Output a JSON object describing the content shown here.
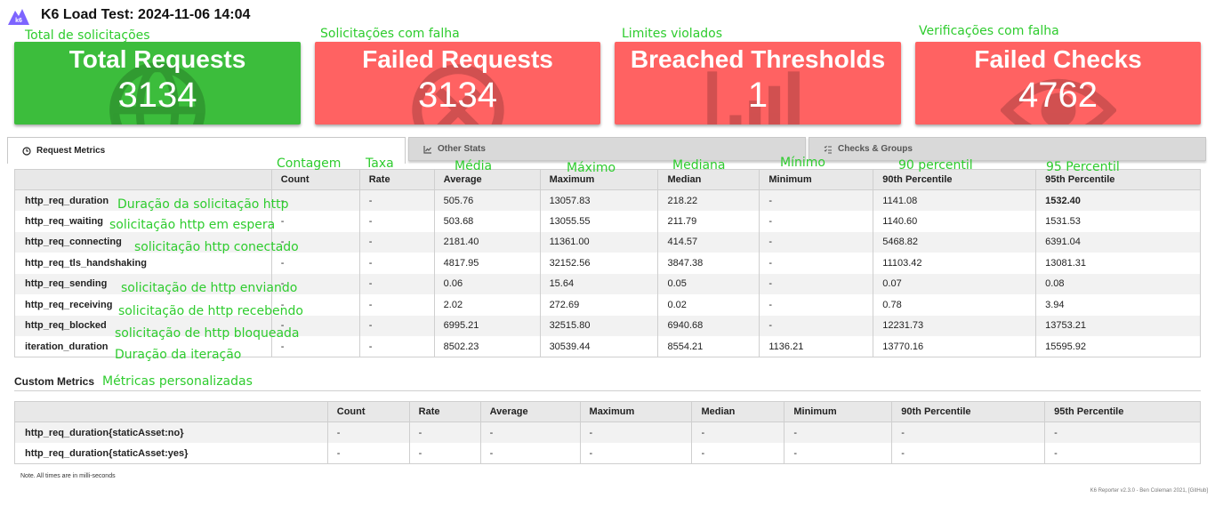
{
  "header": {
    "logo_text": "k6",
    "title": "K6 Load Test: 2024-11-06 14:04"
  },
  "cards": [
    {
      "title": "Total Requests",
      "value": "3134",
      "color": "#3cbd3c",
      "icon": "globe-icon"
    },
    {
      "title": "Failed Requests",
      "value": "3134",
      "color": "#ff6262",
      "icon": "x-circle-icon"
    },
    {
      "title": "Breached Thresholds",
      "value": "1",
      "color": "#ff6262",
      "icon": "bar-chart-icon"
    },
    {
      "title": "Failed Checks",
      "value": "4762",
      "color": "#ff6262",
      "icon": "eye-icon"
    }
  ],
  "tabs": [
    {
      "label": "Request Metrics",
      "icon": "clock-icon",
      "active": true
    },
    {
      "label": "Other Stats",
      "icon": "chart-line-icon",
      "active": false
    },
    {
      "label": "Checks & Groups",
      "icon": "list-check-icon",
      "active": false
    }
  ],
  "request_table": {
    "headers": [
      "",
      "Count",
      "Rate",
      "Average",
      "Maximum",
      "Median",
      "Minimum",
      "90th Percentile",
      "95th Percentile"
    ],
    "rows": [
      [
        "http_req_duration",
        "-",
        "-",
        "505.76",
        "13057.83",
        "218.22",
        "-",
        "1141.08",
        "1532.40"
      ],
      [
        "http_req_waiting",
        "-",
        "-",
        "503.68",
        "13055.55",
        "211.79",
        "-",
        "1140.60",
        "1531.53"
      ],
      [
        "http_req_connecting",
        "-",
        "-",
        "2181.40",
        "11361.00",
        "414.57",
        "-",
        "5468.82",
        "6391.04"
      ],
      [
        "http_req_tls_handshaking",
        "-",
        "-",
        "4817.95",
        "32152.56",
        "3847.38",
        "-",
        "11103.42",
        "13081.31"
      ],
      [
        "http_req_sending",
        "-",
        "-",
        "0.06",
        "15.64",
        "0.05",
        "-",
        "0.07",
        "0.08"
      ],
      [
        "http_req_receiving",
        "-",
        "-",
        "2.02",
        "272.69",
        "0.02",
        "-",
        "0.78",
        "3.94"
      ],
      [
        "http_req_blocked",
        "-",
        "-",
        "6995.21",
        "32515.80",
        "6940.68",
        "-",
        "12231.73",
        "13753.21"
      ],
      [
        "iteration_duration",
        "-",
        "-",
        "8502.23",
        "30539.44",
        "8554.21",
        "1136.21",
        "13770.16",
        "15595.92"
      ]
    ],
    "breached_color": "#ff6262"
  },
  "custom_section_title": "Custom Metrics",
  "custom_table": {
    "headers": [
      "",
      "Count",
      "Rate",
      "Average",
      "Maximum",
      "Median",
      "Minimum",
      "90th Percentile",
      "95th Percentile"
    ],
    "rows": [
      [
        "http_req_duration{staticAsset:no}",
        "-",
        "-",
        "-",
        "-",
        "-",
        "-",
        "-",
        "-"
      ],
      [
        "http_req_duration{staticAsset:yes}",
        "-",
        "-",
        "-",
        "-",
        "-",
        "-",
        "-",
        "-"
      ]
    ]
  },
  "note": "Note. All times are in milli-seconds",
  "footer": "K6 Reporter v2.3.0 - Ben Coleman 2021, [GitHub]",
  "translations": {
    "card_total": "Total de solicitações",
    "card_failed": "Solicitações com falha",
    "card_thresholds": "Limites violados",
    "card_checks": "Verificações com falha",
    "col_count": "Contagem",
    "col_rate": "Taxa",
    "col_average": "Média",
    "col_maximum": "Máximo",
    "col_median": "Mediana",
    "col_minimum": "Mínimo",
    "col_p90": "90 percentil",
    "col_p95": "95 Percentil",
    "row_duration": "Duração da solicitação http",
    "row_waiting": "solicitação http em espera",
    "row_connecting": "solicitação http conectado",
    "row_sending": "solicitação de http enviando",
    "row_receiving": "solicitação de http recebendo",
    "row_blocked": "solicitação de http bloqueada",
    "row_iteration": "Duração da iteração",
    "custom_metrics": "Métricas personalizadas",
    "color": "#2ecc2e"
  }
}
